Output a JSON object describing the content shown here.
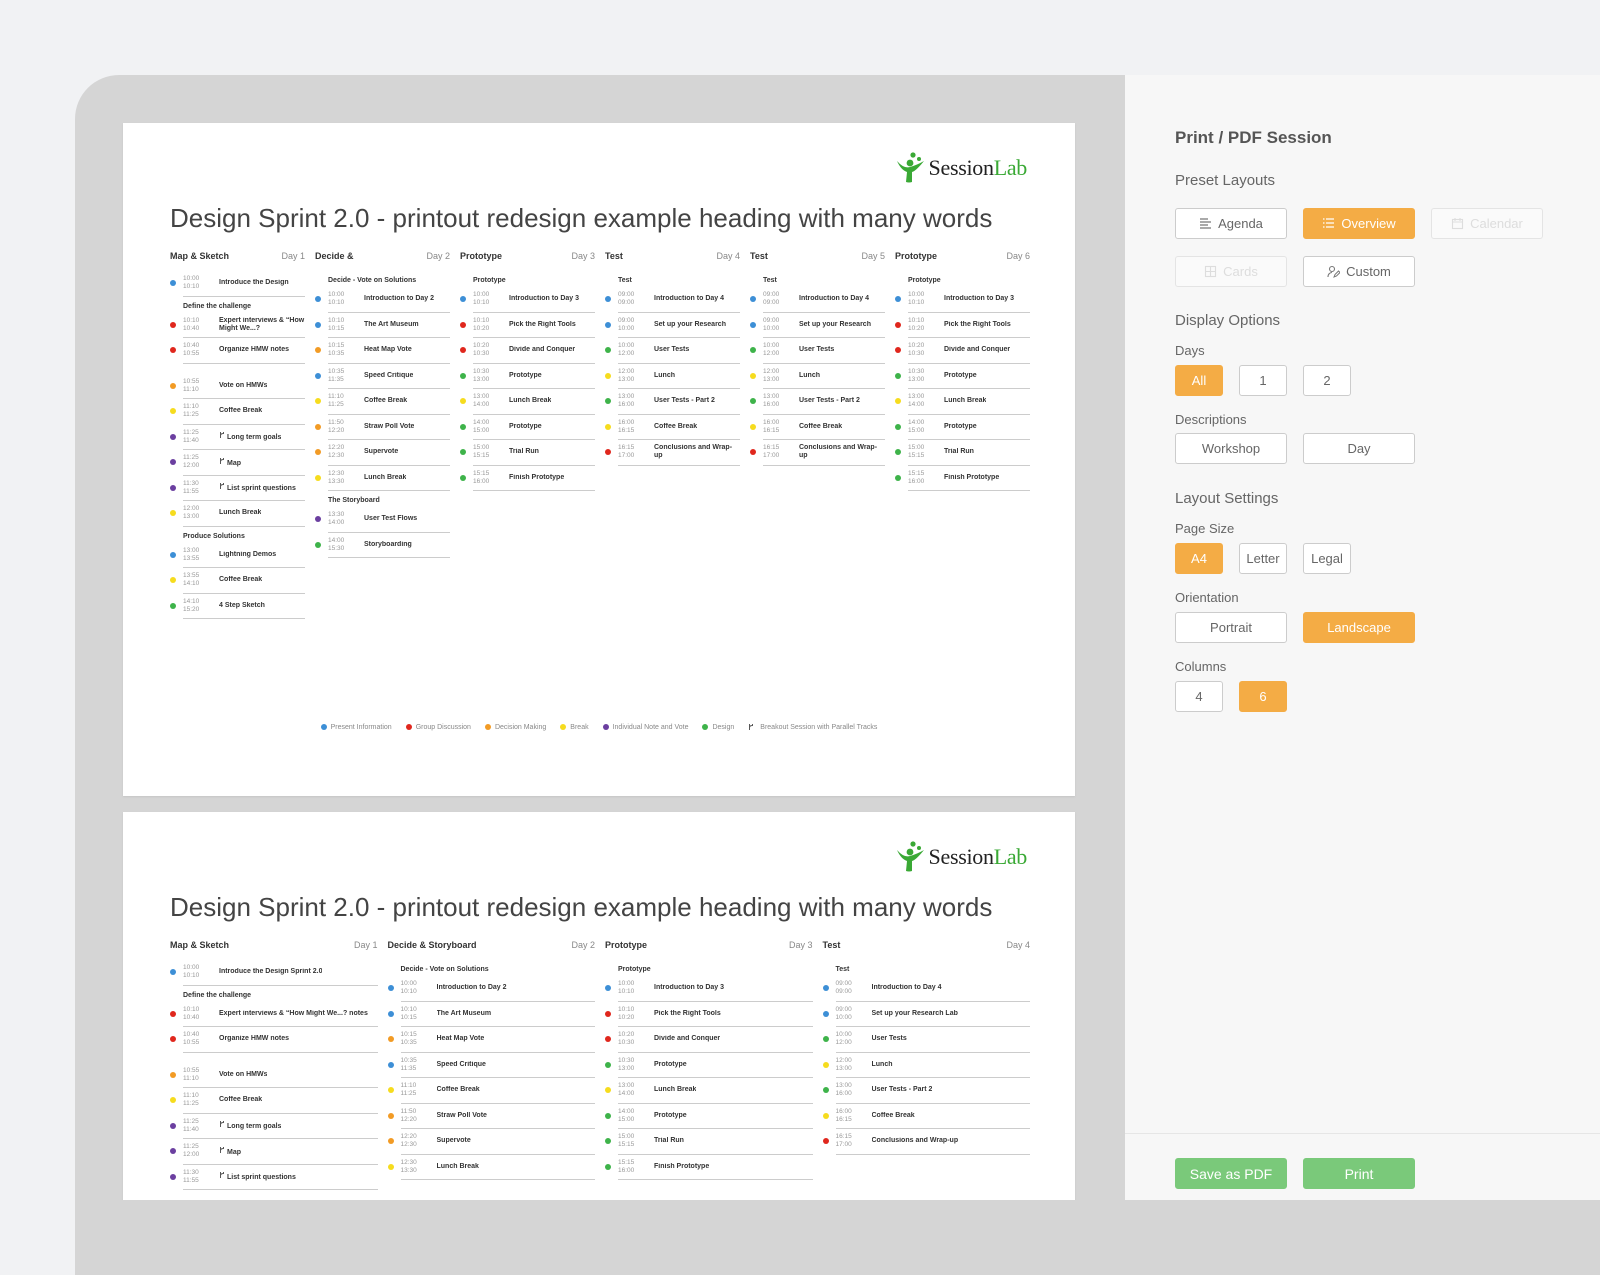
{
  "colors": {
    "accent": "#f4ac45",
    "save": "#7ac97a",
    "legend": {
      "info": "#3d8fd6",
      "discussion": "#e0271d",
      "decision": "#f29b25",
      "break": "#f6dc1e",
      "individual": "#6b3fa0",
      "design": "#3eb34a"
    }
  },
  "logo": {
    "prefix": "Session",
    "suffix": "Lab"
  },
  "pages": [
    {
      "title": "Design Sprint 2.0 - printout redesign example heading with many words",
      "columns": [
        {
          "title": "Map & Sketch",
          "day": "Day 1",
          "rows": [
            {
              "t1": "10:00",
              "t2": "10:10",
              "name": "Introduce the Design",
              "c": "info"
            },
            {
              "section": "Define the challenge"
            },
            {
              "t1": "10:10",
              "t2": "10:40",
              "name": "Expert interviews & “How Might We...?",
              "c": "discussion"
            },
            {
              "t1": "10:40",
              "t2": "10:55",
              "name": "Organize HMW notes",
              "c": "discussion"
            },
            {
              "gap": true
            },
            {
              "t1": "10:55",
              "t2": "11:10",
              "name": "Vote on HMWs",
              "c": "decision"
            },
            {
              "t1": "11:10",
              "t2": "11:25",
              "name": "Coffee Break",
              "c": "break"
            },
            {
              "t1": "11:25",
              "t2": "11:40",
              "name": "Long term goals",
              "c": "individual",
              "br": true
            },
            {
              "t1": "11:25",
              "t2": "12:00",
              "name": "Map",
              "c": "individual",
              "br": true
            },
            {
              "t1": "11:30",
              "t2": "11:55",
              "name": "List sprint questions",
              "c": "individual",
              "br": true
            },
            {
              "t1": "12:00",
              "t2": "13:00",
              "name": "Lunch Break",
              "c": "break"
            },
            {
              "section": "Produce Solutions"
            },
            {
              "t1": "13:00",
              "t2": "13:55",
              "name": "Lightning Demos",
              "c": "info"
            },
            {
              "t1": "13:55",
              "t2": "14:10",
              "name": "Coffee Break",
              "c": "break"
            },
            {
              "t1": "14:10",
              "t2": "15:20",
              "name": "4 Step Sketch",
              "c": "design"
            }
          ]
        },
        {
          "title": "Decide &",
          "day": "Day 2",
          "rows": [
            {
              "section": "Decide - Vote on Solutions"
            },
            {
              "t1": "10:00",
              "t2": "10:10",
              "name": "Introduction to Day 2",
              "c": "info"
            },
            {
              "t1": "10:10",
              "t2": "10:15",
              "name": "The Art Museum",
              "c": "info"
            },
            {
              "t1": "10:15",
              "t2": "10:35",
              "name": "Heat Map Vote",
              "c": "decision"
            },
            {
              "t1": "10:35",
              "t2": "11:35",
              "name": "Speed Critique",
              "c": "info"
            },
            {
              "t1": "11:10",
              "t2": "11:25",
              "name": "Coffee Break",
              "c": "break"
            },
            {
              "t1": "11:50",
              "t2": "12:20",
              "name": "Straw Poll Vote",
              "c": "decision"
            },
            {
              "t1": "12:20",
              "t2": "12:30",
              "name": "Supervote",
              "c": "decision"
            },
            {
              "t1": "12:30",
              "t2": "13:30",
              "name": "Lunch Break",
              "c": "break"
            },
            {
              "section": "The Storyboard"
            },
            {
              "t1": "13:30",
              "t2": "14:00",
              "name": "User Test Flows",
              "c": "individual"
            },
            {
              "t1": "14:00",
              "t2": "15:30",
              "name": "Storyboarding",
              "c": "design"
            }
          ]
        },
        {
          "title": "Prototype",
          "day": "Day 3",
          "rows": [
            {
              "section": "Prototype"
            },
            {
              "t1": "10:00",
              "t2": "10:10",
              "name": "Introduction to Day 3",
              "c": "info"
            },
            {
              "t1": "10:10",
              "t2": "10:20",
              "name": "Pick the Right Tools",
              "c": "discussion"
            },
            {
              "t1": "10:20",
              "t2": "10:30",
              "name": "Divide and Conquer",
              "c": "discussion"
            },
            {
              "t1": "10:30",
              "t2": "13:00",
              "name": "Prototype",
              "c": "design"
            },
            {
              "t1": "13:00",
              "t2": "14:00",
              "name": "Lunch Break",
              "c": "break"
            },
            {
              "t1": "14:00",
              "t2": "15:00",
              "name": "Prototype",
              "c": "design"
            },
            {
              "t1": "15:00",
              "t2": "15:15",
              "name": "Trial Run",
              "c": "design"
            },
            {
              "t1": "15:15",
              "t2": "16:00",
              "name": "Finish Prototype",
              "c": "design"
            }
          ]
        },
        {
          "title": "Test",
          "day": "Day 4",
          "rows": [
            {
              "section": "Test"
            },
            {
              "t1": "09:00",
              "t2": "09:00",
              "name": "Introduction to Day 4",
              "c": "info"
            },
            {
              "t1": "09:00",
              "t2": "10:00",
              "name": "Set up your Research",
              "c": "info"
            },
            {
              "t1": "10:00",
              "t2": "12:00",
              "name": "User Tests",
              "c": "design"
            },
            {
              "t1": "12:00",
              "t2": "13:00",
              "name": "Lunch",
              "c": "break"
            },
            {
              "t1": "13:00",
              "t2": "16:00",
              "name": "User Tests - Part 2",
              "c": "design"
            },
            {
              "t1": "16:00",
              "t2": "16:15",
              "name": "Coffee Break",
              "c": "break"
            },
            {
              "t1": "16:15",
              "t2": "17:00",
              "name": "Conclusions and Wrap-up",
              "c": "discussion"
            }
          ]
        },
        {
          "title": "Test",
          "day": "Day 5",
          "rows": [
            {
              "section": "Test"
            },
            {
              "t1": "09:00",
              "t2": "09:00",
              "name": "Introduction to Day 4",
              "c": "info"
            },
            {
              "t1": "09:00",
              "t2": "10:00",
              "name": "Set up your Research",
              "c": "info"
            },
            {
              "t1": "10:00",
              "t2": "12:00",
              "name": "User Tests",
              "c": "design"
            },
            {
              "t1": "12:00",
              "t2": "13:00",
              "name": "Lunch",
              "c": "break"
            },
            {
              "t1": "13:00",
              "t2": "16:00",
              "name": "User Tests - Part 2",
              "c": "design"
            },
            {
              "t1": "16:00",
              "t2": "16:15",
              "name": "Coffee Break",
              "c": "break"
            },
            {
              "t1": "16:15",
              "t2": "17:00",
              "name": "Conclusions and Wrap-up",
              "c": "discussion"
            }
          ]
        },
        {
          "title": "Prototype",
          "day": "Day 6",
          "rows": [
            {
              "section": "Prototype"
            },
            {
              "t1": "10:00",
              "t2": "10:10",
              "name": "Introduction to Day 3",
              "c": "info"
            },
            {
              "t1": "10:10",
              "t2": "10:20",
              "name": "Pick the Right Tools",
              "c": "discussion"
            },
            {
              "t1": "10:20",
              "t2": "10:30",
              "name": "Divide and Conquer",
              "c": "discussion"
            },
            {
              "t1": "10:30",
              "t2": "13:00",
              "name": "Prototype",
              "c": "design"
            },
            {
              "t1": "13:00",
              "t2": "14:00",
              "name": "Lunch Break",
              "c": "break"
            },
            {
              "t1": "14:00",
              "t2": "15:00",
              "name": "Prototype",
              "c": "design"
            },
            {
              "t1": "15:00",
              "t2": "15:15",
              "name": "Trial Run",
              "c": "design"
            },
            {
              "t1": "15:15",
              "t2": "16:00",
              "name": "Finish Prototype",
              "c": "design"
            }
          ]
        }
      ],
      "legend": [
        {
          "label": "Present Information",
          "c": "info"
        },
        {
          "label": "Group Discussion",
          "c": "discussion"
        },
        {
          "label": "Decision Making",
          "c": "decision"
        },
        {
          "label": "Break",
          "c": "break"
        },
        {
          "label": "Individual Note and Vote",
          "c": "individual"
        },
        {
          "label": "Design",
          "c": "design"
        },
        {
          "label": "Breakout Session with Parallel Tracks",
          "c": "branch"
        }
      ]
    },
    {
      "title": "Design Sprint 2.0 - printout redesign example heading with many words",
      "columns": [
        {
          "title": "Map & Sketch",
          "day": "Day 1",
          "rows": [
            {
              "t1": "10:00",
              "t2": "10:10",
              "name": "Introduce the Design Sprint 2.0",
              "c": "info"
            },
            {
              "section": "Define the challenge"
            },
            {
              "t1": "10:10",
              "t2": "10:40",
              "name": "Expert interviews & “How Might We...? notes",
              "c": "discussion"
            },
            {
              "t1": "10:40",
              "t2": "10:55",
              "name": "Organize HMW notes",
              "c": "discussion"
            },
            {
              "gap": true
            },
            {
              "t1": "10:55",
              "t2": "11:10",
              "name": "Vote on HMWs",
              "c": "decision"
            },
            {
              "t1": "11:10",
              "t2": "11:25",
              "name": "Coffee Break",
              "c": "break"
            },
            {
              "t1": "11:25",
              "t2": "11:40",
              "name": "Long term goals",
              "c": "individual",
              "br": true
            },
            {
              "t1": "11:25",
              "t2": "12:00",
              "name": "Map",
              "c": "individual",
              "br": true
            },
            {
              "t1": "11:30",
              "t2": "11:55",
              "name": "List sprint questions",
              "c": "individual",
              "br": true
            }
          ]
        },
        {
          "title": "Decide & Storyboard",
          "day": "Day 2",
          "rows": [
            {
              "section": "Decide - Vote on Solutions"
            },
            {
              "t1": "10:00",
              "t2": "10:10",
              "name": "Introduction to Day 2",
              "c": "info"
            },
            {
              "t1": "10:10",
              "t2": "10:15",
              "name": "The Art Museum",
              "c": "info"
            },
            {
              "t1": "10:15",
              "t2": "10:35",
              "name": "Heat Map Vote",
              "c": "decision"
            },
            {
              "t1": "10:35",
              "t2": "11:35",
              "name": "Speed Critique",
              "c": "info"
            },
            {
              "t1": "11:10",
              "t2": "11:25",
              "name": "Coffee Break",
              "c": "break"
            },
            {
              "t1": "11:50",
              "t2": "12:20",
              "name": "Straw Poll Vote",
              "c": "decision"
            },
            {
              "t1": "12:20",
              "t2": "12:30",
              "name": "Supervote",
              "c": "decision"
            },
            {
              "t1": "12:30",
              "t2": "13:30",
              "name": "Lunch Break",
              "c": "break"
            }
          ]
        },
        {
          "title": "Prototype",
          "day": "Day 3",
          "rows": [
            {
              "section": "Prototype"
            },
            {
              "t1": "10:00",
              "t2": "10:10",
              "name": "Introduction to Day 3",
              "c": "info"
            },
            {
              "t1": "10:10",
              "t2": "10:20",
              "name": "Pick the Right Tools",
              "c": "discussion"
            },
            {
              "t1": "10:20",
              "t2": "10:30",
              "name": "Divide and Conquer",
              "c": "discussion"
            },
            {
              "t1": "10:30",
              "t2": "13:00",
              "name": "Prototype",
              "c": "design"
            },
            {
              "t1": "13:00",
              "t2": "14:00",
              "name": "Lunch Break",
              "c": "break"
            },
            {
              "t1": "14:00",
              "t2": "15:00",
              "name": "Prototype",
              "c": "design"
            },
            {
              "t1": "15:00",
              "t2": "15:15",
              "name": "Trial Run",
              "c": "design"
            },
            {
              "t1": "15:15",
              "t2": "16:00",
              "name": "Finish Prototype",
              "c": "design"
            }
          ]
        },
        {
          "title": "Test",
          "day": "Day 4",
          "rows": [
            {
              "section": "Test"
            },
            {
              "t1": "09:00",
              "t2": "09:00",
              "name": "Introduction to Day 4",
              "c": "info"
            },
            {
              "t1": "09:00",
              "t2": "10:00",
              "name": "Set up your Research Lab",
              "c": "info"
            },
            {
              "t1": "10:00",
              "t2": "12:00",
              "name": "User Tests",
              "c": "design"
            },
            {
              "t1": "12:00",
              "t2": "13:00",
              "name": "Lunch",
              "c": "break"
            },
            {
              "t1": "13:00",
              "t2": "16:00",
              "name": "User Tests - Part 2",
              "c": "design"
            },
            {
              "t1": "16:00",
              "t2": "16:15",
              "name": "Coffee Break",
              "c": "break"
            },
            {
              "t1": "16:15",
              "t2": "17:00",
              "name": "Conclusions and Wrap-up",
              "c": "discussion"
            }
          ]
        }
      ]
    }
  ],
  "panel": {
    "title": "Print / PDF Session",
    "preset_heading": "Preset Layouts",
    "presets": {
      "agenda": "Agenda",
      "overview": "Overview",
      "calendar": "Calendar",
      "cards": "Cards",
      "custom": "Custom"
    },
    "display_heading": "Display Options",
    "days_label": "Days",
    "days": {
      "all": "All",
      "one": "1",
      "two": "2"
    },
    "descriptions_label": "Descriptions",
    "descriptions": {
      "workshop": "Workshop",
      "day": "Day"
    },
    "layout_heading": "Layout Settings",
    "page_size_label": "Page Size",
    "page_size": {
      "a4": "A4",
      "letter": "Letter",
      "legal": "Legal"
    },
    "orientation_label": "Orientation",
    "orientation": {
      "portrait": "Portrait",
      "landscape": "Landscape"
    },
    "columns_label": "Columns",
    "columns": {
      "four": "4",
      "six": "6"
    },
    "save_label": "Save as PDF",
    "print_label": "Print"
  }
}
